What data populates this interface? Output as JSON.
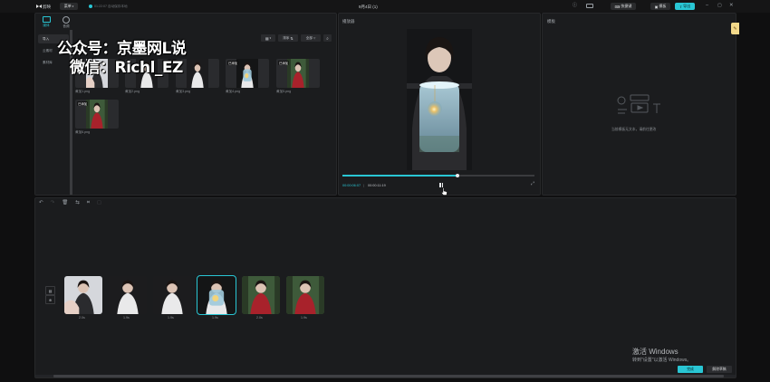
{
  "app": {
    "logo_text": "剪映",
    "menu_label": "菜单",
    "autosave_text": "01:22:07 自动保存本地",
    "window_title": "9月4日 (1)"
  },
  "topbar": {
    "shortcut_label": "快捷键",
    "template_label": "模板",
    "export_label": "导出"
  },
  "media_panel": {
    "tabs": [
      {
        "label": "媒体"
      },
      {
        "label": "音频"
      }
    ],
    "side_items": [
      {
        "label": "导入"
      },
      {
        "label": "云素材"
      },
      {
        "label": "素材库"
      }
    ],
    "sort_label": "排序",
    "all_label": "全部",
    "watermark_line1": "公众号：京墨网L说",
    "watermark_line2": "微信：Richl_EZ",
    "items": [
      {
        "name": "黄加1.png",
        "tag": "",
        "kind": "portrait"
      },
      {
        "name": "黄加2.png",
        "tag": "",
        "kind": "dark"
      },
      {
        "name": "黄加3.png",
        "tag": "",
        "kind": "dark"
      },
      {
        "name": "黄加4.png",
        "tag": "已添加",
        "kind": "lamp"
      },
      {
        "name": "黄加5.png",
        "tag": "已添加",
        "kind": "red"
      },
      {
        "name": "黄加6.png",
        "tag": "已添加",
        "kind": "red"
      }
    ]
  },
  "player": {
    "title": "播放器",
    "current_time": "00:00:06:07",
    "total_time": "00:00:11:19",
    "progress": 0.6
  },
  "draft_panel": {
    "title": "模板",
    "empty_text": "当前模板无文本，请前往更改"
  },
  "timeline": {
    "clips": [
      {
        "duration": "2.0s",
        "kind": "portrait",
        "selected": false
      },
      {
        "duration": "1.9s",
        "kind": "dark",
        "selected": false
      },
      {
        "duration": "1.9s",
        "kind": "dark",
        "selected": false
      },
      {
        "duration": "1.9s",
        "kind": "lamp",
        "selected": true
      },
      {
        "duration": "2.0s",
        "kind": "red",
        "selected": false
      },
      {
        "duration": "1.9s",
        "kind": "red",
        "selected": false
      }
    ]
  },
  "activation": {
    "line1": "激活 Windows",
    "line2": "转到\"设置\"以激活 Windows。"
  },
  "bottom_buttons": {
    "done_label": "完成",
    "cancel_label": "解除草稿"
  },
  "colors": {
    "accent": "#29c6d4",
    "panel": "#1b1c1e",
    "background": "#0f0f10"
  }
}
